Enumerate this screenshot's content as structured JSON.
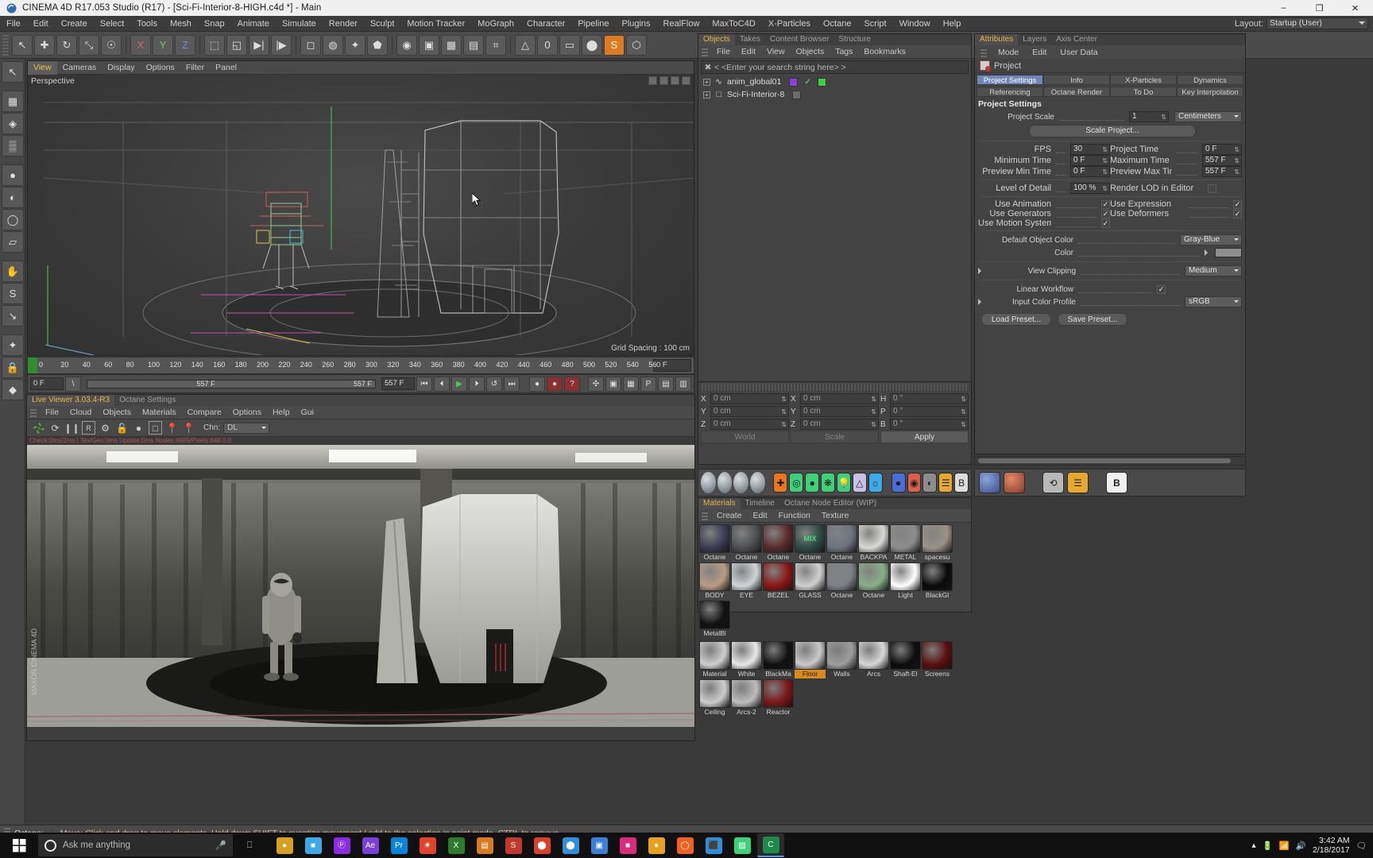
{
  "window": {
    "title": "CINEMA 4D R17.053 Studio (R17) - [Sci-Fi-Interior-8-HIGH.c4d *] - Main",
    "app_icon": "cinema4d-icon",
    "minimize": "–",
    "maximize": "❐",
    "close": "✕"
  },
  "menubar": {
    "items": [
      "File",
      "Edit",
      "Create",
      "Select",
      "Tools",
      "Mesh",
      "Snap",
      "Animate",
      "Simulate",
      "Render",
      "Sculpt",
      "Motion Tracker",
      "MoGraph",
      "Character",
      "Pipeline",
      "Plugins",
      "RealFlow",
      "MaxToC4D",
      "X-Particles",
      "Octane",
      "Script",
      "Window",
      "Help"
    ],
    "layout_label": "Layout:",
    "layout_value": "Startup (User)"
  },
  "toolbar_top": {
    "buttons": [
      "↖",
      "✚",
      "↻",
      "⤡",
      "☉",
      "X",
      "Y",
      "Z",
      "⬚",
      "◱",
      "▶|",
      "|▶",
      "◻",
      "◍",
      "✦",
      "⬟",
      "◉",
      "▣",
      "▦",
      "▤",
      "⌗",
      "△",
      "0",
      "▭",
      "⬤",
      "S",
      "⬡"
    ]
  },
  "toolbar_left": {
    "buttons": [
      "↖",
      "▦",
      "◈",
      "▒",
      "●",
      "◐",
      "◯",
      "▱",
      "✋",
      "S",
      "↘",
      "✦",
      "🔒",
      "◆"
    ]
  },
  "viewport": {
    "menu": [
      "View",
      "Cameras",
      "Display",
      "Options",
      "Filter",
      "Panel"
    ],
    "active_menu": "View",
    "label": "Perspective",
    "grid_spacing": "Grid Spacing : 100 cm"
  },
  "timeline": {
    "ticks": [
      "0",
      "20",
      "40",
      "60",
      "80",
      "100",
      "120",
      "140",
      "160",
      "180",
      "200",
      "220",
      "240",
      "260",
      "280",
      "300",
      "320",
      "340",
      "360",
      "380",
      "400",
      "420",
      "440",
      "460",
      "480",
      "500",
      "520",
      "540",
      "56"
    ],
    "current_frame_field": "0 F"
  },
  "playbar": {
    "current": "0 F",
    "range_end": "557 F",
    "end_frame": "557 F",
    "buttons": [
      "⏮",
      "⏴",
      "▶",
      "⏵",
      "↺",
      "⏭"
    ],
    "extra_buttons": [
      "●",
      "●",
      "?",
      "✣",
      "▣",
      "▦",
      "P",
      "▤",
      "▥"
    ]
  },
  "liveviewer": {
    "tabs": [
      "Live Viewer 3.03.4-R3",
      "Octane Settings"
    ],
    "active_tab": "Live Viewer 3.03.4-R3",
    "menu": [
      "File",
      "Cloud",
      "Objects",
      "Materials",
      "Compare",
      "Options",
      "Help",
      "Gui"
    ],
    "toolbar_icons": [
      "octane-fan-icon",
      "refresh-icon",
      "pause-icon",
      "region-icon",
      "gear-icon",
      "unlock-icon",
      "sphere-icon",
      "picture-icon",
      "focus-pin-icon",
      "material-pin-icon"
    ],
    "chn_label": "Chn:",
    "chn_value": "DL",
    "status": "Check:0ms/2ms | Tex/Geo:0ms  Update:0ms   Nodes:4989/Pixels:848  0.0"
  },
  "statusbar": {
    "mode": "Octane:",
    "message": "Move: Click and drag to move elements. Hold down SHIFT to quantize movement / add to the selection in point mode, CTRL to remove."
  },
  "objects_panel": {
    "tabs": [
      "Objects",
      "Takes",
      "Content Browser",
      "Structure"
    ],
    "active_tab": "Objects",
    "menu": [
      "File",
      "Edit",
      "View",
      "Objects",
      "Tags",
      "Bookmarks"
    ],
    "search_placeholder": "< <Enter your search string here> >",
    "rows": [
      {
        "name": "anim_global01",
        "icon": "spline-icon"
      },
      {
        "name": "Sci-Fi-Interior-8",
        "icon": "null-object-icon"
      }
    ]
  },
  "coordinates": {
    "rows": [
      {
        "axis": "X",
        "pos": "0 cm",
        "size": "0 cm",
        "rot_label": "H",
        "rot": "0 °"
      },
      {
        "axis": "Y",
        "pos": "0 cm",
        "size": "0 cm",
        "rot_label": "P",
        "rot": "0 °"
      },
      {
        "axis": "Z",
        "pos": "0 cm",
        "size": "0 cm",
        "rot_label": "B",
        "rot": "0 °"
      }
    ],
    "world_btn": "World",
    "scale_btn": "Scale",
    "apply_btn": "Apply"
  },
  "materials_panel": {
    "tabs": [
      "Materials",
      "Timeline",
      "Octane Node Editor (WIP)"
    ],
    "active_tab": "Materials",
    "menu": [
      "Create",
      "Edit",
      "Function",
      "Texture"
    ],
    "row1": [
      {
        "name": "Octane",
        "color": "#3a3a55"
      },
      {
        "name": "Octane",
        "color": "#4d4f52"
      },
      {
        "name": "Octane",
        "color": "#5a2b2b"
      },
      {
        "name": "Octane",
        "color": "#2e4a44",
        "badge": "MIX"
      },
      {
        "name": "Octane",
        "color": "#6d7480"
      },
      {
        "name": "BACKPA",
        "color": "#d8d8d4"
      },
      {
        "name": "METAL",
        "color": "#8d8d8d"
      },
      {
        "name": "spacesu",
        "color": "#9a9086"
      },
      {
        "name": "BODY",
        "color": "#b89c86"
      },
      {
        "name": "EYE",
        "color": "#cfd4d8"
      },
      {
        "name": "BEZEL",
        "color": "#8c1414"
      },
      {
        "name": "GLASS",
        "color": "#d0d0d0"
      },
      {
        "name": "Octane",
        "color": "#7d8188"
      },
      {
        "name": "Octane",
        "color": "#88b088"
      },
      {
        "name": "Light",
        "color": "#ffffff"
      },
      {
        "name": "BlackGl",
        "color": "#0a0a0a"
      },
      {
        "name": "MetalBl",
        "color": "#111111"
      }
    ],
    "row2": [
      {
        "name": "Material",
        "color": "#cfcfcf"
      },
      {
        "name": "White",
        "color": "#e8e8e8"
      },
      {
        "name": "BlackMa",
        "color": "#101010"
      },
      {
        "name": "Floor",
        "color": "#c9c9c9",
        "selected": true
      },
      {
        "name": "Walls",
        "color": "#9d9d9d"
      },
      {
        "name": "Arcs",
        "color": "#d8d8d8"
      },
      {
        "name": "Shaft-El",
        "color": "#0d0d0d"
      },
      {
        "name": "Screens",
        "color": "#5a0f0f"
      },
      {
        "name": "Ceiling",
        "color": "#cdcdcd"
      },
      {
        "name": "Arcs-2",
        "color": "#bdbdbd"
      },
      {
        "name": "Reactor",
        "color": "#7a1616"
      }
    ]
  },
  "attributes_panel": {
    "tabs": [
      "Attributes",
      "Layers",
      "Axis Center"
    ],
    "active_tab": "Attributes",
    "menu": [
      "Mode",
      "Edit",
      "User Data"
    ],
    "object_label": "Project",
    "mode_tabs_row1": [
      "Project Settings",
      "Info",
      "X-Particles",
      "Dynamics"
    ],
    "mode_tabs_row2": [
      "Referencing",
      "Octane Render",
      "To Do",
      "Key Interpolation"
    ],
    "active_mode_tab": "Project Settings",
    "section_title": "Project Settings",
    "project_scale_label": "Project Scale",
    "project_scale_value": "1",
    "project_scale_unit": "Centimeters",
    "scale_project_btn": "Scale Project...",
    "fps_label": "FPS",
    "fps_value": "30",
    "project_time_label": "Project Time",
    "project_time_value": "0 F",
    "min_time_label": "Minimum Time",
    "min_time_value": "0 F",
    "max_time_label": "Maximum Time",
    "max_time_value": "557 F",
    "prev_min_label": "Preview Min Time",
    "prev_min_value": "0 F",
    "prev_max_label": "Preview Max Time",
    "prev_max_value": "557 F",
    "lod_label": "Level of Detail",
    "lod_value": "100 %",
    "render_lod_label": "Render LOD in Editor",
    "render_lod_checked": false,
    "use_animation_label": "Use Animation",
    "use_animation_checked": true,
    "use_expression_label": "Use Expression",
    "use_expression_checked": true,
    "use_generators_label": "Use Generators",
    "use_generators_checked": true,
    "use_deformers_label": "Use Deformers",
    "use_deformers_checked": true,
    "use_motion_label": "Use Motion System",
    "use_motion_checked": true,
    "default_color_label": "Default Object Color",
    "default_color_value": "Gray-Blue",
    "color_label": "Color",
    "view_clipping_label": "View Clipping",
    "view_clipping_value": "Medium",
    "linear_workflow_label": "Linear Workflow",
    "linear_workflow_checked": true,
    "input_profile_label": "Input Color Profile",
    "input_profile_value": "sRGB",
    "load_preset_btn": "Load Preset...",
    "save_preset_btn": "Save Preset..."
  },
  "taskbar": {
    "search_placeholder": "Ask me anything",
    "apps": [
      "●",
      "■",
      "Ⓟ",
      "Ae",
      "Pr",
      "✷",
      "X",
      "▤",
      "S",
      "⬤",
      "⬤",
      "▣",
      "■",
      "●",
      "◯",
      "⬛",
      "▧",
      "C"
    ],
    "clock_time": "3:42 AM",
    "clock_date": "2/18/2017"
  }
}
